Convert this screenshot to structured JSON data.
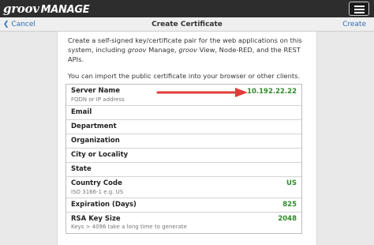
{
  "app": {
    "logo_groov": "groov",
    "logo_manage": "MANAGE"
  },
  "nav": {
    "back_label": "Cancel",
    "title": "Create Certificate",
    "action_label": "Create"
  },
  "intro": {
    "para1_a": "Create a self-signed key/certificate pair for the web applications on this system, including ",
    "para1_b": "groov",
    "para1_c": " Manage, ",
    "para1_d": "groov",
    "para1_e": " View, Node-RED, and the REST APIs.",
    "para2": "You can import the public certificate into your browser or other clients."
  },
  "fields": [
    {
      "label": "Server Name",
      "hint": "FQDN or IP address",
      "value": "10.192.22.22"
    },
    {
      "label": "Email",
      "hint": "",
      "value": ""
    },
    {
      "label": "Department",
      "hint": "",
      "value": ""
    },
    {
      "label": "Organization",
      "hint": "",
      "value": ""
    },
    {
      "label": "City or Locality",
      "hint": "",
      "value": ""
    },
    {
      "label": "State",
      "hint": "",
      "value": ""
    },
    {
      "label": "Country Code",
      "hint": "ISO 3166-1 e.g. US",
      "value": "US"
    },
    {
      "label": "Expiration (Days)",
      "hint": "",
      "value": "825"
    },
    {
      "label": "RSA Key Size",
      "hint": "Keys > 4096 take a long time to generate",
      "value": "2048"
    }
  ],
  "colors": {
    "accent": "#2f6db5",
    "value_green": "#2e8b27",
    "arrow_red": "#e23b3b",
    "topbar": "#2d2d2d"
  },
  "icons": {
    "back": "chevron-left-icon",
    "menu": "hamburger-menu-icon",
    "annotation": "red-arrow-icon"
  }
}
